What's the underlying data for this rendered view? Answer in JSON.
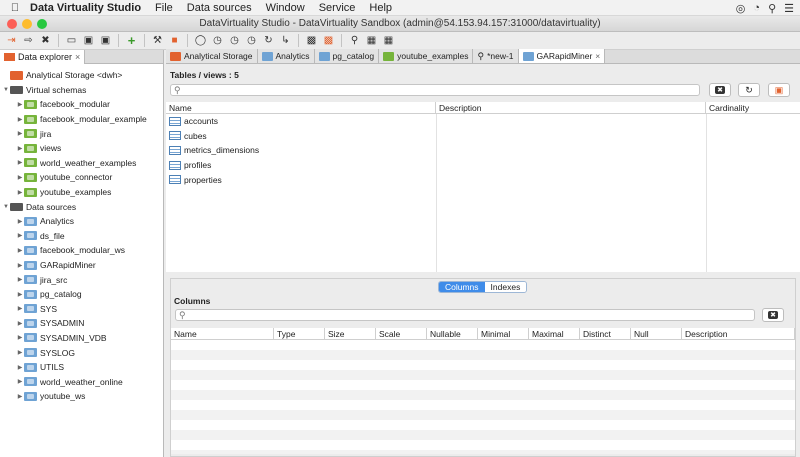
{
  "menubar": {
    "app_name": "Data Virtuality Studio",
    "menus": [
      "File",
      "Data sources",
      "Window",
      "Service",
      "Help"
    ]
  },
  "window": {
    "title": "DataVirtuality Studio - DataVirtuality Sandbox (admin@54.153.94.157:31000/datavirtuality)"
  },
  "left_panel": {
    "tab_label": "Data explorer",
    "tree": {
      "storage": "Analytical Storage <dwh>",
      "virtual_schemas_label": "Virtual schemas",
      "virtual_schemas": [
        "facebook_modular",
        "facebook_modular_example",
        "jira",
        "views",
        "world_weather_examples",
        "youtube_connector",
        "youtube_examples"
      ],
      "data_sources_label": "Data sources",
      "data_sources": [
        "Analytics",
        "ds_file",
        "facebook_modular_ws",
        "GARapidMiner",
        "jira_src",
        "pg_catalog",
        "SYS",
        "SYSADMIN",
        "SYSADMIN_VDB",
        "SYSLOG",
        "UTILS",
        "world_weather_online",
        "youtube_ws"
      ]
    }
  },
  "editor_tabs": [
    {
      "label": "Analytical Storage",
      "color": "#e2622f"
    },
    {
      "label": "Analytics",
      "color": "#6fa3d4"
    },
    {
      "label": "pg_catalog",
      "color": "#6fa3d4"
    },
    {
      "label": "youtube_examples",
      "color": "#76b43b"
    },
    {
      "label": "*new-1",
      "color": "#888888"
    },
    {
      "label": "GARapidMiner",
      "color": "#6fa3d4",
      "active": true
    }
  ],
  "tables": {
    "title": "Tables / views : 5",
    "headers": [
      "Name",
      "Description",
      "Cardinality"
    ],
    "rows": [
      "accounts",
      "cubes",
      "metrics_dimensions",
      "profiles",
      "properties"
    ]
  },
  "columns": {
    "segments": [
      "Columns",
      "Indexes"
    ],
    "title": "Columns",
    "headers": [
      "Name",
      "Type",
      "Size",
      "Scale",
      "Nullable",
      "Minimal",
      "Maximal",
      "Distinct",
      "Null",
      "Description"
    ]
  }
}
